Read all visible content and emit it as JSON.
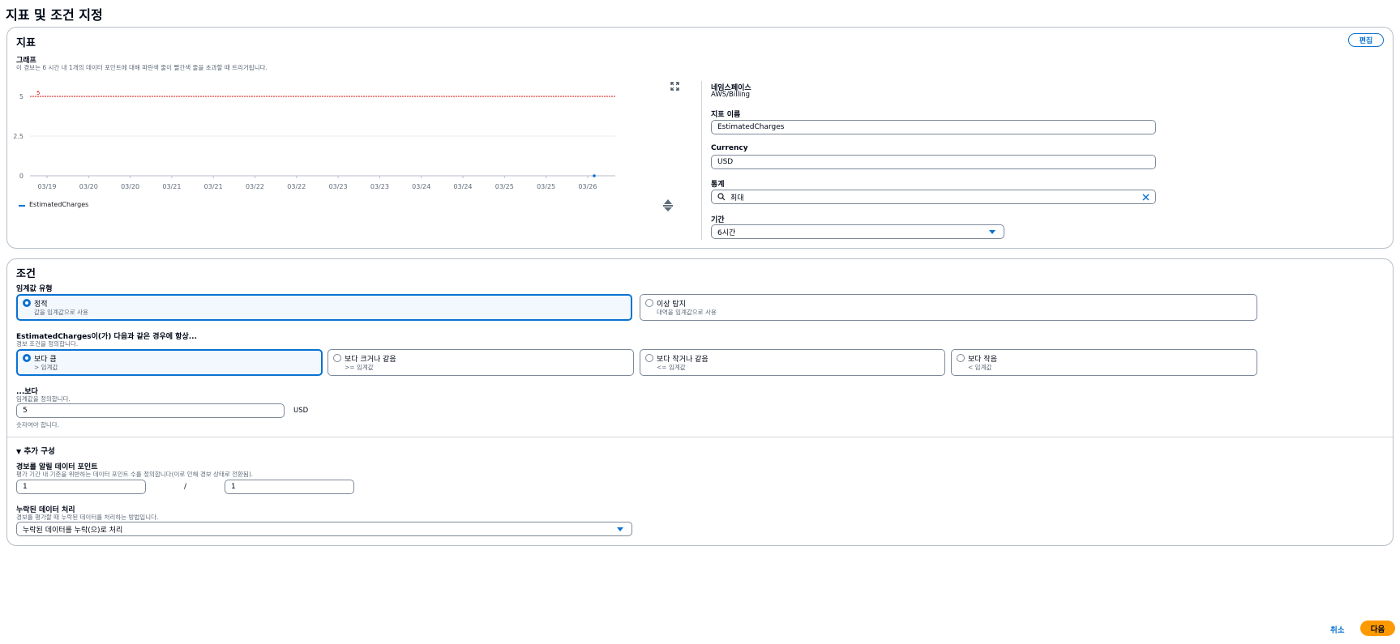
{
  "page": {
    "title": "지표 및 조건 지정"
  },
  "metric": {
    "title": "지표",
    "edit_label": "편집",
    "graph": {
      "label": "그래프",
      "description": "이 경보는 6 시간 내 1개의 데이터 포인트에 대해 파란색 줄이 빨간색 줄을 초과할 때 트리거됩니다.",
      "threshold_label": "5",
      "y_ticks": [
        "5",
        "2.5",
        "0"
      ],
      "x_ticks": [
        "03/19",
        "03/20",
        "03/20",
        "03/21",
        "03/21",
        "03/22",
        "03/22",
        "03/23",
        "03/23",
        "03/24",
        "03/24",
        "03/25",
        "03/25",
        "03/26"
      ],
      "legend": "EstimatedCharges",
      "colors": {
        "threshold": "#d91515",
        "series": "#0972d3",
        "grid": "#e9ebed"
      }
    },
    "namespace": {
      "label": "네임스페이스",
      "value": "AWS/Billing"
    },
    "metric_name": {
      "label": "지표 이름",
      "value": "EstimatedCharges"
    },
    "currency": {
      "label": "Currency",
      "value": "USD"
    },
    "statistic": {
      "label": "통계",
      "value": "최대"
    },
    "period": {
      "label": "기간",
      "value": "6시간"
    }
  },
  "conditions": {
    "title": "조건",
    "threshold_type": {
      "label": "임계값 유형",
      "options": [
        {
          "title": "정적",
          "desc": "값을 임계값으로 사용",
          "selected": true
        },
        {
          "title": "이상 탐지",
          "desc": "대역을 임계값으로 사용",
          "selected": false
        }
      ]
    },
    "whenever": {
      "label": "EstimatedCharges이(가) 다음과 같은 경우에 항상...",
      "desc": "경보 조건을 정의합니다.",
      "options": [
        {
          "title": "보다 큼",
          "desc": "> 임계값",
          "selected": true
        },
        {
          "title": "보다 크거나 같음",
          "desc": ">= 임계값",
          "selected": false
        },
        {
          "title": "보다 작거나 같음",
          "desc": "<= 임계값",
          "selected": false
        },
        {
          "title": "보다 작음",
          "desc": "< 임계값",
          "selected": false
        }
      ]
    },
    "than": {
      "label": "...보다",
      "desc": "임계값을 정의합니다.",
      "value": "5",
      "unit": "USD",
      "hint": "숫자여야 합니다."
    },
    "additional": {
      "toggle_label": "추가 구성",
      "datapoints": {
        "label": "경보를 알릴 데이터 포인트",
        "desc": "평가 기간 내 기준을 위반하는 데이터 포인트 수를 정의합니다(이로 인해 경보 상태로 전환됨).",
        "value_a": "1",
        "separator": "/",
        "value_b": "1"
      },
      "missing_data": {
        "label": "누락된 데이터 처리",
        "desc": "경보를 평가할 때 누락된 데이터를 처리하는 방법입니다.",
        "value": "누락된 데이터를 누락(으)로 처리"
      }
    }
  },
  "footer": {
    "cancel_label": "취소",
    "next_label": "다음"
  }
}
